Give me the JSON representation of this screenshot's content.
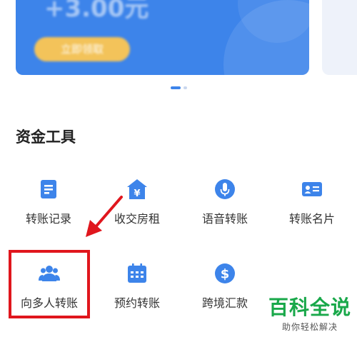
{
  "banner": {
    "amount_text": "+3.00元",
    "button_label": "立即领取"
  },
  "section": {
    "title": "资金工具"
  },
  "tools": [
    {
      "label": "转账记录",
      "icon": "document-list-icon"
    },
    {
      "label": "收交房租",
      "icon": "house-yen-icon"
    },
    {
      "label": "语音转账",
      "icon": "microphone-icon"
    },
    {
      "label": "转账名片",
      "icon": "id-card-icon"
    },
    {
      "label": "向多人转账",
      "icon": "multiple-users-icon"
    },
    {
      "label": "预约转账",
      "icon": "calendar-icon"
    },
    {
      "label": "跨境汇款",
      "icon": "dollar-coin-icon"
    }
  ],
  "watermark": {
    "main": "百科全说",
    "sub": "助你轻松解决"
  },
  "colors": {
    "accent": "#3d84ea",
    "highlight": "#e0161d",
    "watermark": "#19a84a"
  }
}
